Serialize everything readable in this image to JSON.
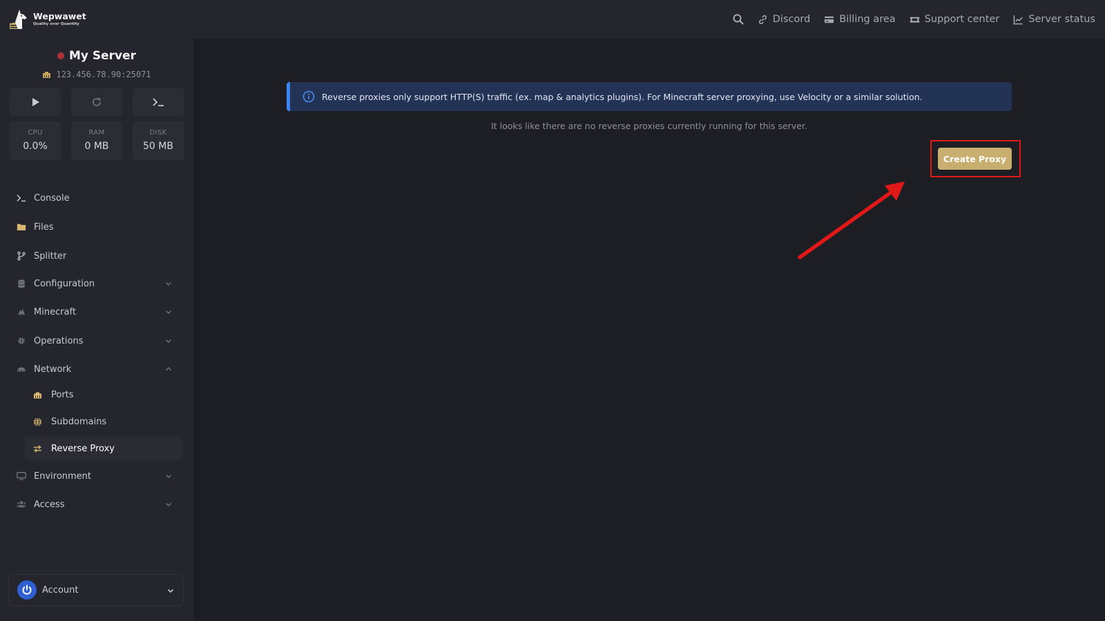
{
  "brand": {
    "name": "Wepwawet",
    "tagline": "Quality over Quantity"
  },
  "topnav": {
    "search_icon": "search-icon",
    "links": [
      {
        "label": "Discord",
        "icon": "link-icon"
      },
      {
        "label": "Billing area",
        "icon": "credit-card-icon"
      },
      {
        "label": "Support center",
        "icon": "ticket-icon"
      },
      {
        "label": "Server status",
        "icon": "chart-line-icon"
      }
    ]
  },
  "server": {
    "name": "My Server",
    "status_color": "#b0303a",
    "address": "123.456.78.90:25071",
    "controls": [
      "play-icon",
      "restart-icon",
      "terminal-icon"
    ],
    "stats": [
      {
        "label": "CPU",
        "value": "0.0%"
      },
      {
        "label": "RAM",
        "value": "0 MB"
      },
      {
        "label": "DISK",
        "value": "50 MB"
      }
    ]
  },
  "sidebar": {
    "items": [
      {
        "label": "Console",
        "icon": "terminal-icon"
      },
      {
        "label": "Files",
        "icon": "folder-icon"
      },
      {
        "label": "Splitter",
        "icon": "code-branch-icon"
      },
      {
        "label": "Configuration",
        "icon": "database-icon",
        "expandable": true
      },
      {
        "label": "Minecraft",
        "icon": "minecraft-icon",
        "expandable": true
      },
      {
        "label": "Operations",
        "icon": "gear-icon",
        "expandable": true
      },
      {
        "label": "Network",
        "icon": "network-icon",
        "expandable": true,
        "expanded": true
      },
      {
        "label": "Environment",
        "icon": "monitor-icon",
        "expandable": true
      },
      {
        "label": "Access",
        "icon": "users-icon",
        "expandable": true
      }
    ],
    "network_children": [
      {
        "label": "Ports",
        "icon": "ethernet-icon"
      },
      {
        "label": "Subdomains",
        "icon": "globe-icon"
      },
      {
        "label": "Reverse Proxy",
        "icon": "arrows-exchange-icon",
        "active": true
      }
    ],
    "account_label": "Account"
  },
  "main": {
    "alert_text": "Reverse proxies only support HTTP(S) traffic (ex. map & analytics plugins). For Minecraft server proxying, use Velocity or a similar solution.",
    "empty_text": "It looks like there are no reverse proxies currently running for this server.",
    "create_button": "Create Proxy"
  },
  "colors": {
    "accent": "#c8ae6f",
    "info": "#3b82f6",
    "annotation": "#e01818",
    "avatar": "#2f5fd0"
  }
}
